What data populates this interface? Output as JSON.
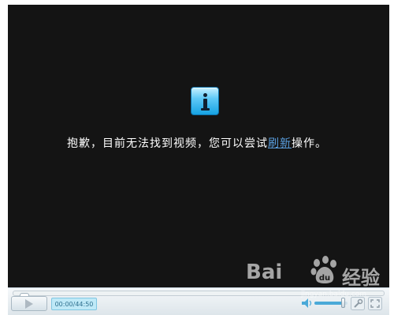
{
  "player": {
    "message_prefix": "抱歉，目前无法找到视频，您可以尝试",
    "refresh_link": "刷新",
    "message_suffix": "操作。",
    "icon": "info-icon"
  },
  "controls": {
    "time": "00:00/44:50",
    "progress": 0.0,
    "volume": 0.85,
    "play_icon": "play-icon",
    "volume_icon": "speaker-icon",
    "settings_icon": "wrench-icon",
    "fullscreen_icon": "fullscreen-icon"
  },
  "watermark": {
    "brand": "Bai",
    "brand_tag": "经验",
    "url": "jingyan.baidu.com"
  },
  "colors": {
    "screen": "#141414",
    "link": "#5a9fe0",
    "accent": "#4aa9d8"
  }
}
